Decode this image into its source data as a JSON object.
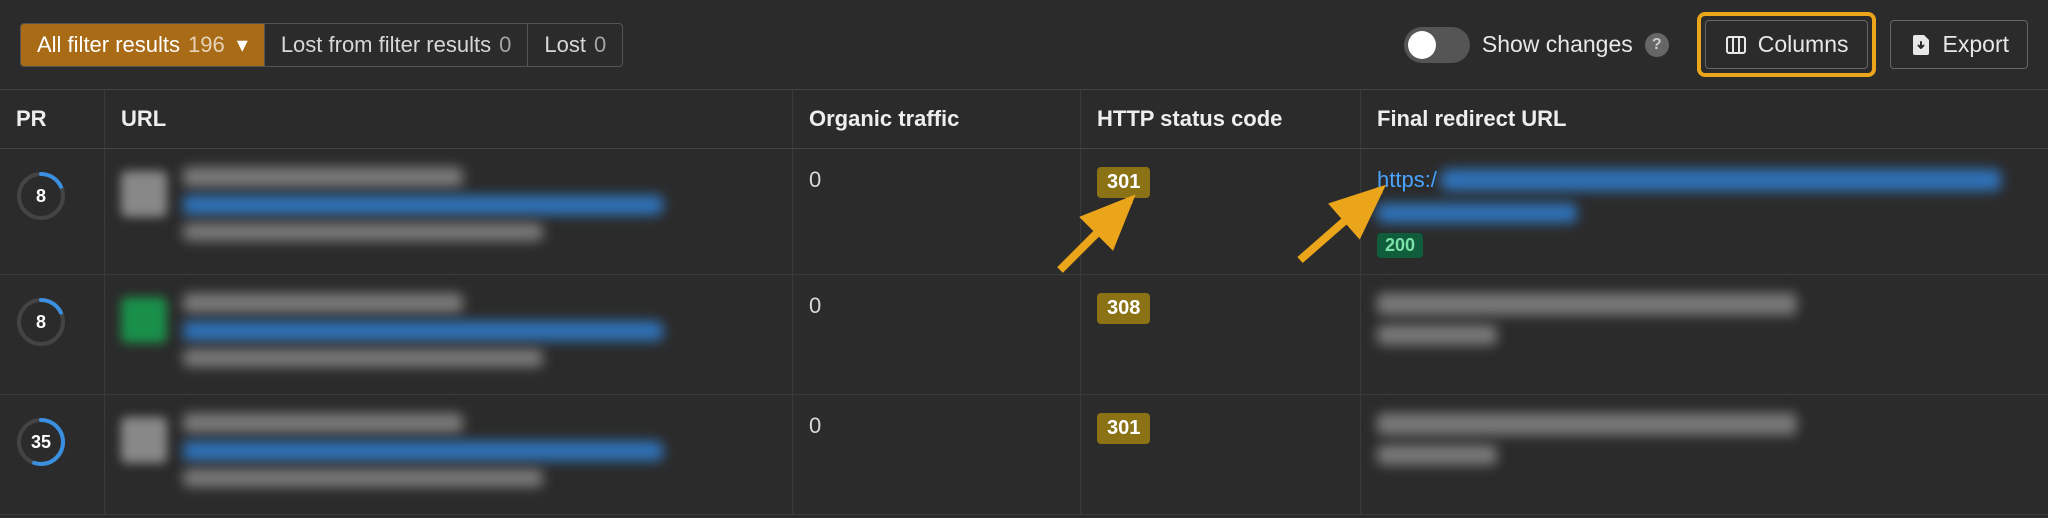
{
  "toolbar": {
    "filters": [
      {
        "label": "All filter results",
        "count": "196",
        "active": true,
        "has_caret": true
      },
      {
        "label": "Lost from filter results",
        "count": "0",
        "active": false,
        "has_caret": false
      },
      {
        "label": "Lost",
        "count": "0",
        "active": false,
        "has_caret": false
      }
    ],
    "show_changes_label": "Show changes",
    "columns_label": "Columns",
    "export_label": "Export"
  },
  "columns": {
    "pr": "PR",
    "url": "URL",
    "traffic": "Organic traffic",
    "http": "HTTP status code",
    "redirect": "Final redirect URL"
  },
  "rows": [
    {
      "pr": "8",
      "pr_pct": 18,
      "favicon_color": "gray",
      "traffic": "0",
      "http_status": "301",
      "http_class": "status-3xx",
      "redirect_prefix": "https:/",
      "redirect_status": "200"
    },
    {
      "pr": "8",
      "pr_pct": 18,
      "favicon_color": "green",
      "traffic": "0",
      "http_status": "308",
      "http_class": "status-3xx",
      "redirect_prefix": "",
      "redirect_status": ""
    },
    {
      "pr": "35",
      "pr_pct": 55,
      "favicon_color": "gray",
      "traffic": "0",
      "http_status": "301",
      "http_class": "status-3xx",
      "redirect_prefix": "",
      "redirect_status": ""
    }
  ],
  "colors": {
    "accent": "#eba51a",
    "ring": "#3a8fe0"
  }
}
